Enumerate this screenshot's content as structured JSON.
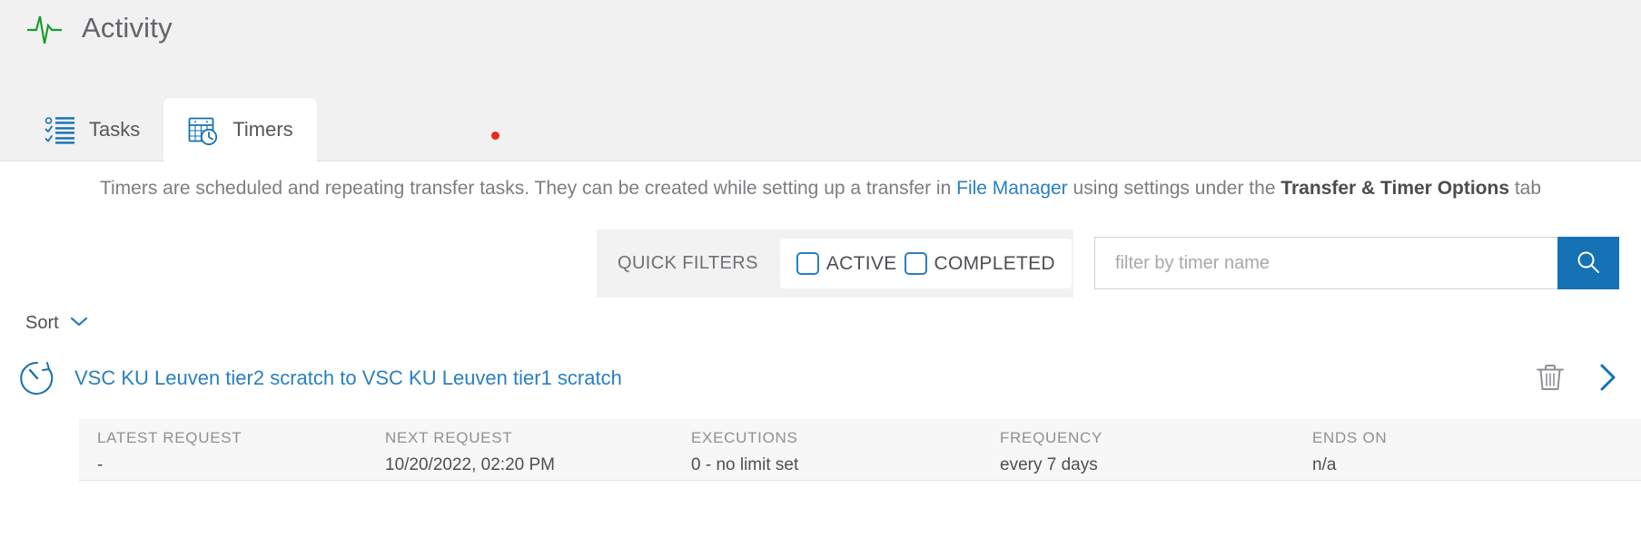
{
  "header": {
    "title": "Activity",
    "icon": "pulse-icon",
    "icon_color": "#1a9c2e"
  },
  "tabs": [
    {
      "label": "Tasks",
      "icon": "checklist-icon",
      "active": false
    },
    {
      "label": "Timers",
      "icon": "calendar-clock-icon",
      "active": true
    }
  ],
  "notification_dot": {
    "color": "#e8291c"
  },
  "description": {
    "part1": "Timers are scheduled and repeating transfer tasks. They can be created while setting up a transfer in ",
    "link": "File Manager",
    "part2": " using settings under the ",
    "bold": "Transfer & Timer Options",
    "part3": " tab"
  },
  "quick_filters": {
    "label": "QUICK FILTERS",
    "options": [
      {
        "label": "ACTIVE",
        "checked": false
      },
      {
        "label": "COMPLETED",
        "checked": false
      }
    ]
  },
  "search": {
    "value": "",
    "placeholder": "filter by timer name",
    "button_icon": "search-icon",
    "button_color": "#1571b3"
  },
  "sort": {
    "label": "Sort",
    "icon": "chevron-down-icon"
  },
  "timers": [
    {
      "icon": "stopwatch-icon",
      "title": "VSC KU Leuven tier2 scratch to VSC KU Leuven tier1 scratch",
      "delete_icon": "trash-icon",
      "expand_icon": "chevron-right-icon",
      "details": [
        {
          "header": "LATEST REQUEST",
          "value": "-"
        },
        {
          "header": "NEXT REQUEST",
          "value": "10/20/2022, 02:20 PM"
        },
        {
          "header": "EXECUTIONS",
          "value": "0 - no limit set"
        },
        {
          "header": "FREQUENCY",
          "value": "every 7 days"
        },
        {
          "header": "ENDS ON",
          "value": "n/a"
        }
      ]
    }
  ],
  "colors": {
    "accent_blue": "#2a7fc0",
    "button_blue": "#1571b3",
    "band_grey": "#f1f1f1",
    "panel_grey": "#f7f7f7",
    "text_grey": "#4d4f54"
  }
}
